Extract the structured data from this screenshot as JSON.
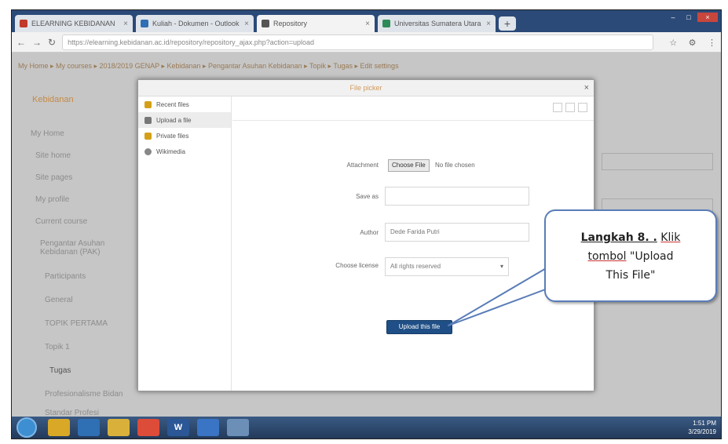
{
  "browser": {
    "tabs": [
      {
        "title": "ELEARNING KEBIDANAN",
        "color": "#c0392b",
        "active": false
      },
      {
        "title": "Kuliah - Dokumen - Outlook",
        "color": "#2f6fb3",
        "active": false
      },
      {
        "title": "Repository",
        "color": "#555555",
        "active": true
      },
      {
        "title": "Universitas Sumatera Utara",
        "color": "#2e8b57",
        "active": false
      }
    ],
    "new_tab": "+",
    "url": "https://elearning.kebidanan.ac.id/repository/repository_ajax.php?action=upload",
    "back": "←",
    "forward": "→",
    "reload": "↻"
  },
  "page": {
    "breadcrumb": "My Home ▸ My courses ▸ 2018/2019 GENAP ▸ Kebidanan ▸ Pengantar Asuhan Kebidanan ▸ Topik ▸ Tugas ▸ Edit settings",
    "site_name": "Kebidanan",
    "nav_items": [
      "My Home",
      "Site home",
      "Site pages",
      "My profile",
      "Current course",
      "Pengantar Asuhan Kebidanan (PAK)",
      "Participants",
      "General",
      "TOPIK PERTAMA",
      "Topik 1",
      "Tugas",
      "Profesionalisme Bidan",
      "Standar Profesi"
    ]
  },
  "dialog": {
    "title": "File picker",
    "close": "×",
    "repos": [
      {
        "label": "Recent files",
        "color": "#d4a017"
      },
      {
        "label": "Upload a file",
        "color": "#777777"
      },
      {
        "label": "Private files",
        "color": "#d4a017"
      },
      {
        "label": "Wikimedia",
        "color": "#888888"
      }
    ],
    "attachment_label": "Attachment",
    "choose_file": "Choose File",
    "no_file": "No file chosen",
    "save_as_label": "Save as",
    "save_as_value": "",
    "author_label": "Author",
    "author_value": "Dede Farida Putri",
    "license_label": "Choose license",
    "license_value": "All rights reserved",
    "upload_button": "Upload this file"
  },
  "callout": {
    "line1_bold": "Langkah 8. .",
    "line1_rest": "Klik",
    "line2_ul": "tombol",
    "line2_rest": "\"Upload",
    "line3": "This File\""
  },
  "taskbar": {
    "apps": [
      {
        "label": "",
        "color": "#d9a826"
      },
      {
        "label": "",
        "color": "#2f6fb3"
      },
      {
        "label": "",
        "color": "#d9b13a"
      },
      {
        "label": "",
        "color": "#dd4b39"
      },
      {
        "label": "W",
        "color": "#2b5797"
      },
      {
        "label": "",
        "color": "#3a74c4"
      },
      {
        "label": "",
        "color": "#6c8fb8"
      }
    ],
    "time": "1:51 PM",
    "date": "3/29/2019"
  }
}
